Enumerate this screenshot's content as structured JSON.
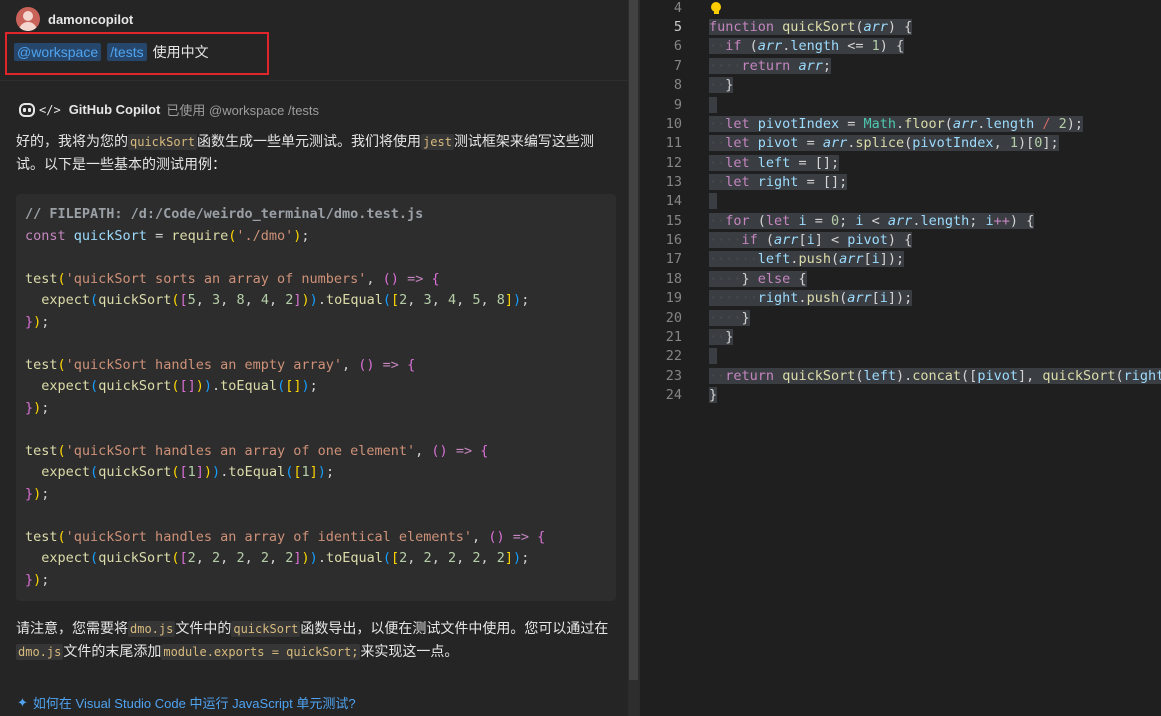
{
  "chat": {
    "user": {
      "name": "damoncopilot"
    },
    "request": {
      "mention": "@workspace",
      "command": "/tests",
      "text": "使用中文"
    },
    "bot": {
      "name": "GitHub Copilot",
      "used_prefix": "已使用",
      "used_refs": "@workspace /tests"
    },
    "intro": {
      "p1": "好的，我将为您的",
      "c1": "quickSort",
      "p2": "函数生成一些单元测试。我们将使用",
      "c2": "jest",
      "p3": "测试框架来编写这些测试。以下是一些基本的测试用例："
    },
    "code_comment": "// FILEPATH: /d:/Code/weirdo_terminal/dmo.test.js",
    "note": {
      "p1": "请注意，您需要将",
      "c1": "dmo.js",
      "p2": "文件中的",
      "c2": "quickSort",
      "p3": "函数导出，以便在测试文件中使用。您可以通过在",
      "c3": "dmo.js",
      "p4": "文件的末尾添加",
      "c4": "module.exports = quickSort;",
      "p5": "来实现这一点。"
    },
    "followup": "如何在 Visual Studio Code 中运行 JavaScript 单元测试?"
  },
  "editor": {
    "line_numbers": [
      "4",
      "5",
      "6",
      "7",
      "8",
      "9",
      "10",
      "11",
      "12",
      "13",
      "14",
      "15",
      "16",
      "17",
      "18",
      "19",
      "20",
      "21",
      "22",
      "23",
      "24"
    ]
  },
  "colors": {
    "accent": "#4fa3f0",
    "highlight_border": "#e0262b",
    "chip_bg": "#26476b"
  }
}
